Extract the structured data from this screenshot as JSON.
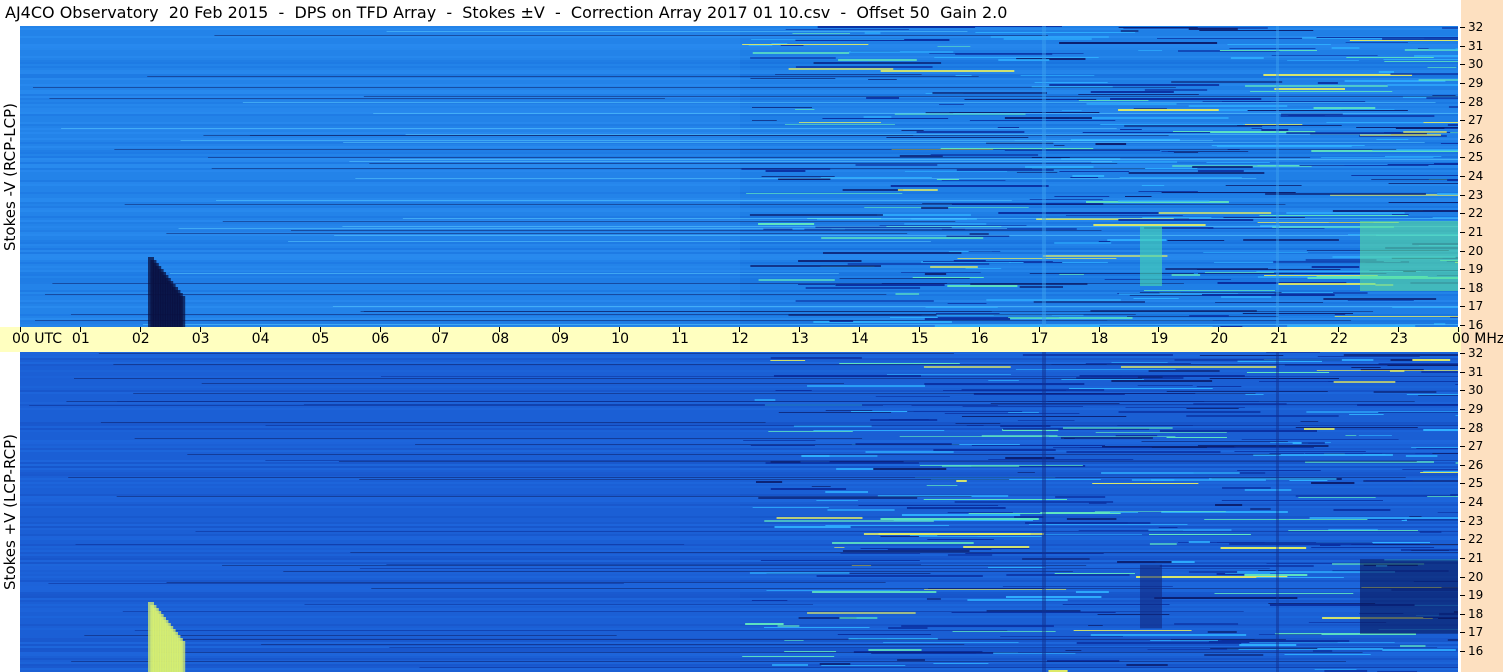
{
  "title": "AJ4CO Observatory  20 Feb 2015  -  DPS on TFD Array  -  Stokes ±V  -  Correction Array 2017 01 10.csv  -  Offset 50  Gain 2.0",
  "top_panel": {
    "label": "Stokes -V (RCP-LCP)"
  },
  "bottom_panel": {
    "label": "Stokes +V (LCP-RCP)"
  },
  "time_axis": {
    "ticks": [
      "00  UTC",
      "01",
      "02",
      "03",
      "04",
      "05",
      "06",
      "07",
      "08",
      "09",
      "10",
      "11",
      "12",
      "13",
      "14",
      "15",
      "16",
      "17",
      "18",
      "19",
      "20",
      "21",
      "22",
      "23",
      "00 MHz"
    ]
  },
  "freq_axis": {
    "ticks": [
      "32",
      "31",
      "30",
      "29",
      "28",
      "27",
      "26",
      "25",
      "24",
      "23",
      "22",
      "21",
      "20",
      "19",
      "18",
      "17",
      "16"
    ]
  },
  "colors": {
    "title_bg": "#ffffff",
    "utc_bar": "#ffffc0",
    "right_strip": "#fde0c0",
    "spectro_top_base": "#1f7fe6",
    "spectro_bottom_base": "#1a5fd4"
  }
}
